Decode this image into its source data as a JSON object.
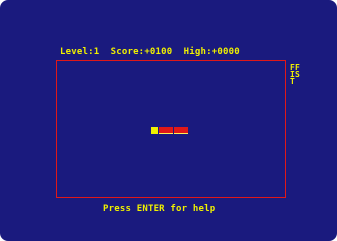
{
  "hud": {
    "level_label": "Level:",
    "level": "1",
    "score_label": "Score:",
    "score": "+0100",
    "high_label": "High:",
    "high": "+0000"
  },
  "side_label": [
    "FF",
    "IS",
    "T"
  ],
  "help_text": "Press ENTER for help",
  "snake": {
    "length_segments": 5,
    "direction": "left"
  },
  "colors": {
    "background": "#1a1a7e",
    "text": "#f0f000",
    "border": "#e01818",
    "snake_body": "#e01818",
    "snake_head": "#f0f000"
  }
}
